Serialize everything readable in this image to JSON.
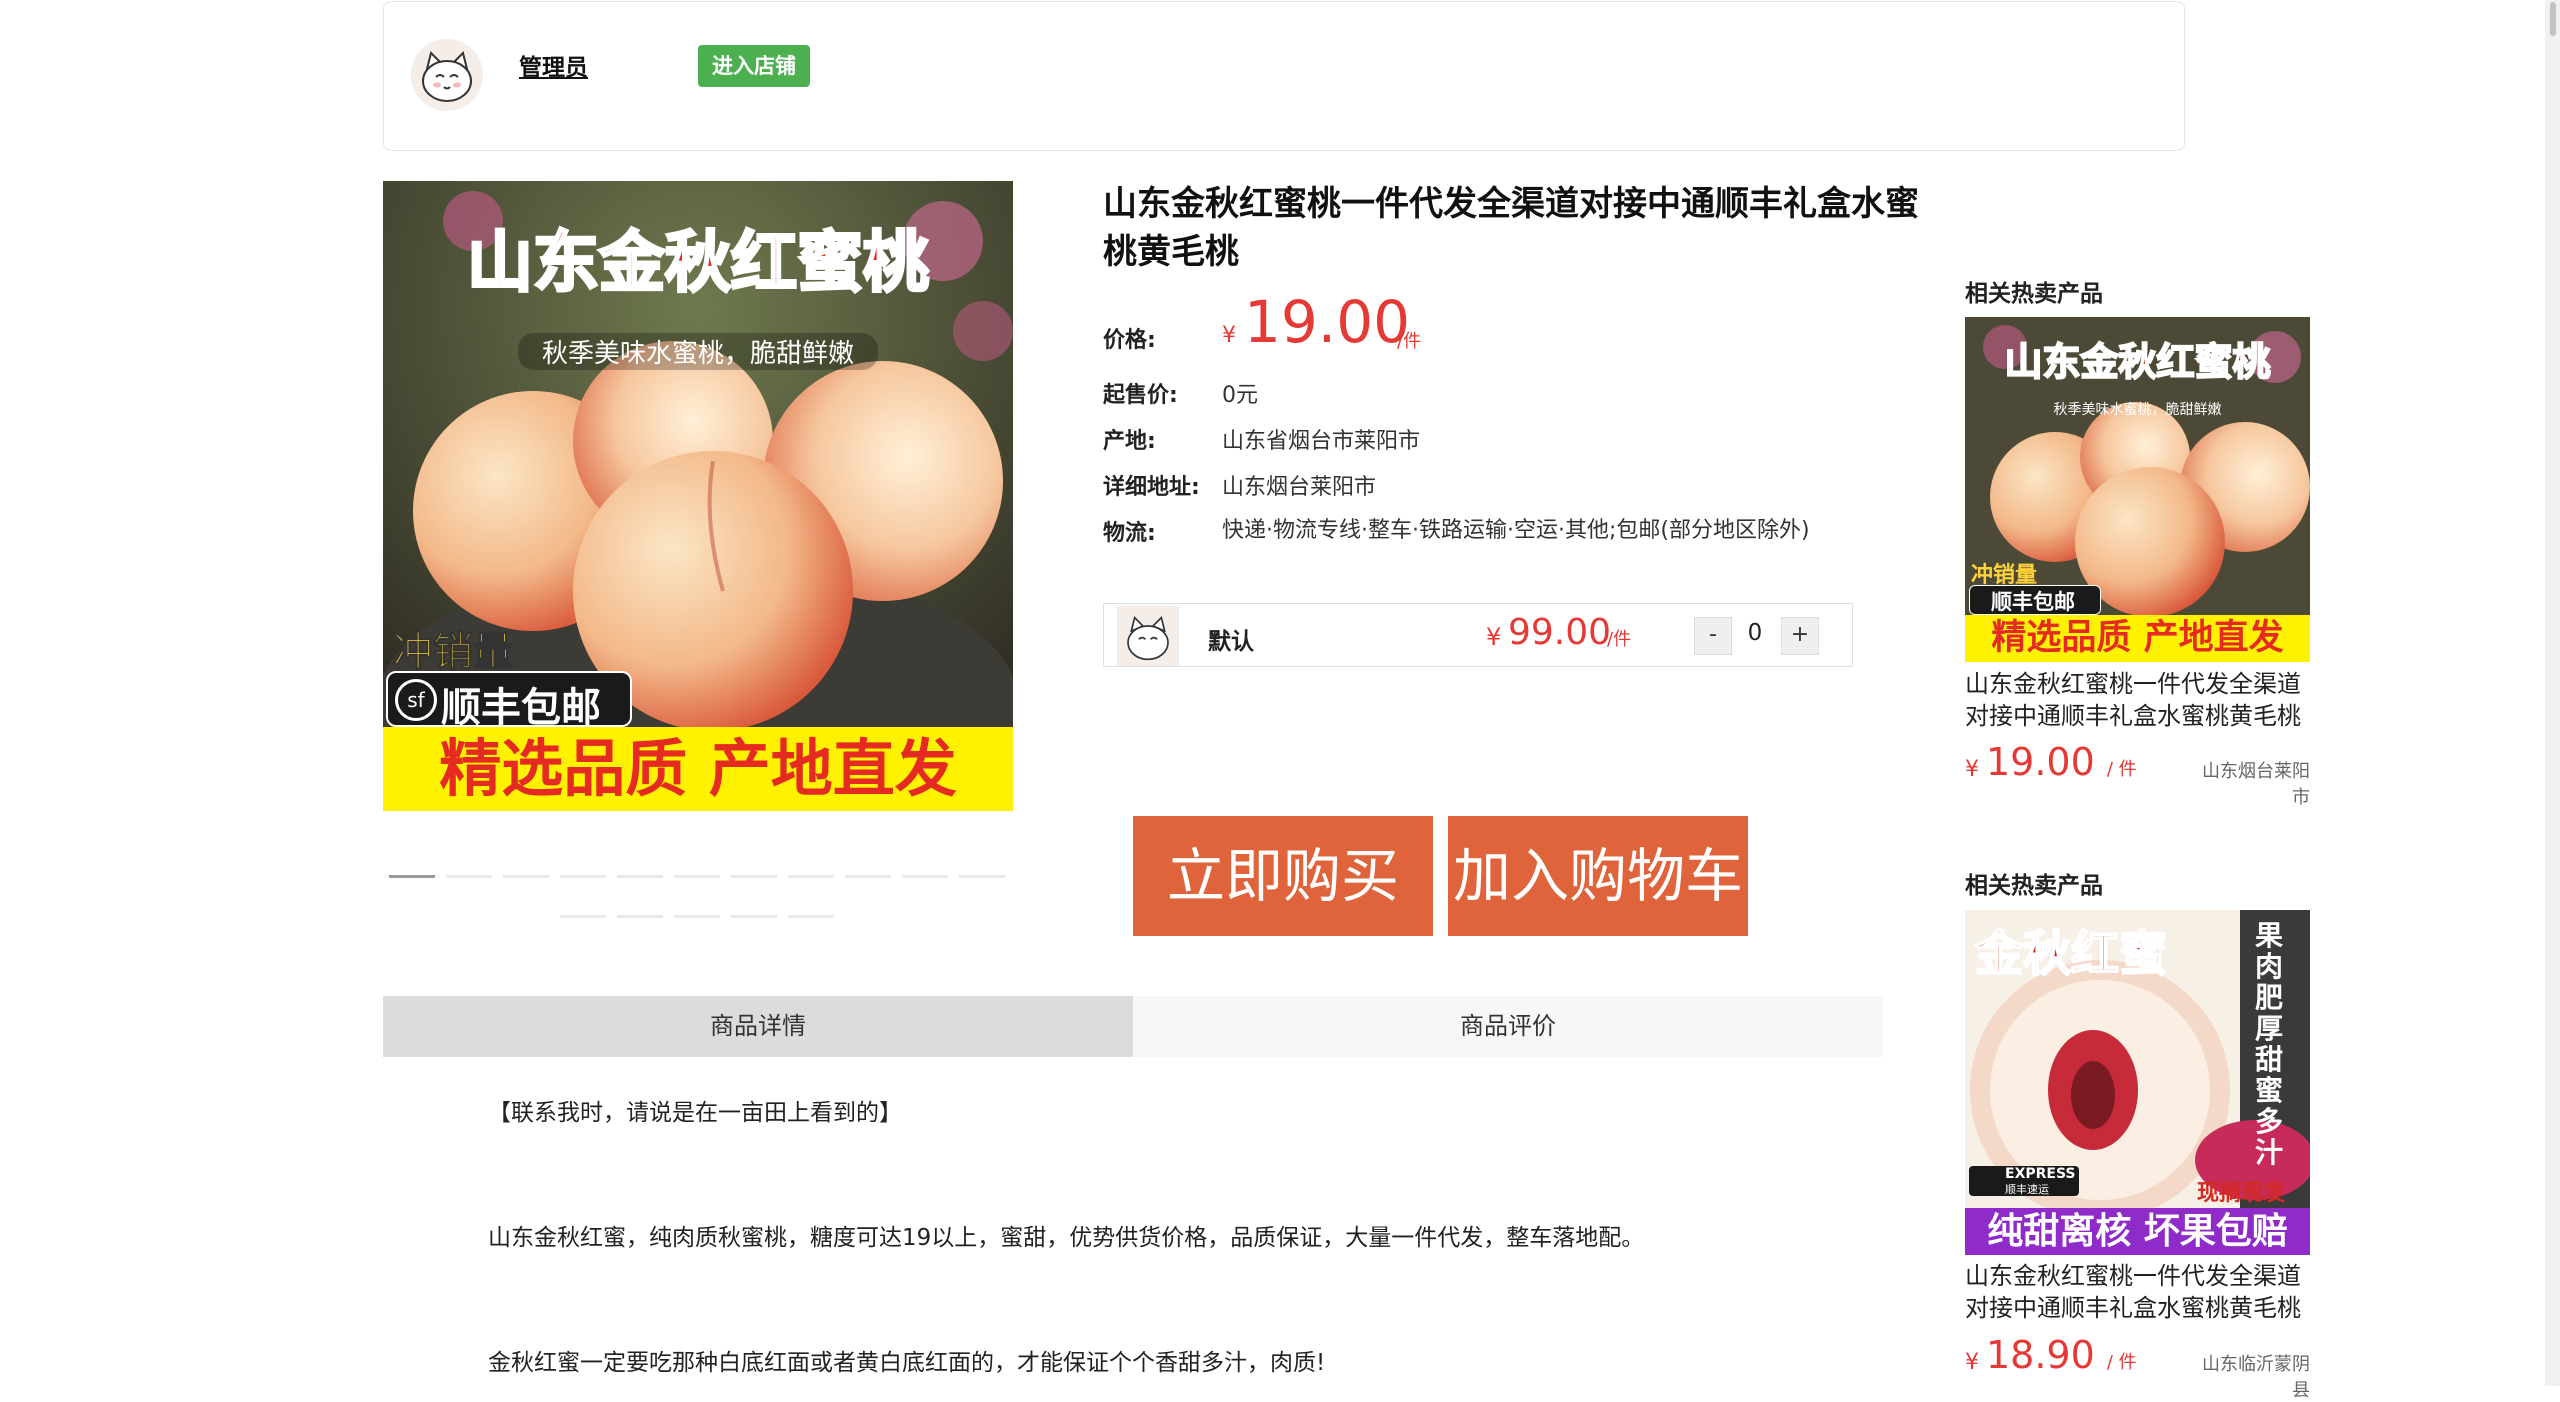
{
  "shop": {
    "name": "管理员",
    "enter_button": "进入店铺"
  },
  "main_image": {
    "headline": "山东金秋红蜜桃",
    "subline": "秋季美味水蜜桃，脆甜鲜嫩",
    "sticker_top": "冲销量",
    "sticker_sf": "顺丰包邮",
    "banner": "精选品质 产地直发",
    "sf_logo": "sf"
  },
  "product": {
    "title": "山东金秋红蜜桃一件代发全渠道对接中通顺丰礼盒水蜜桃黄毛桃",
    "price_label": "价格:",
    "currency": "¥",
    "price": "19.00",
    "price_unit": "/件",
    "min_label": "起售价:",
    "min_value": "0元",
    "origin_label": "产地:",
    "origin_value": "山东省烟台市莱阳市",
    "address_label": "详细地址:",
    "address_value": "山东烟台莱阳市",
    "logistics_label": "物流:",
    "logistics_value": "快递·物流专线·整车·铁路运输·空运·其他;包邮(部分地区除外)"
  },
  "sku": {
    "name": "默认",
    "currency": "¥",
    "price": "99.00",
    "unit": "/件",
    "minus": "-",
    "qty": "0",
    "plus": "+"
  },
  "actions": {
    "buy_now": "立即购买",
    "add_cart": "加入购物车"
  },
  "tabs": {
    "details": "商品详情",
    "reviews": "商品评价"
  },
  "detail_paragraphs": [
    "【联系我时，请说是在一亩田上看到的】",
    "山东金秋红蜜，纯肉质秋蜜桃，糖度可达19以上，蜜甜，优势供货价格，品质保证，大量一件代发，整车落地配。",
    "金秋红蜜一定要吃那种白底红面或者黄白底红面的，才能保证个个香甜多汁，肉质!"
  ],
  "sidebar": [
    {
      "heading": "相关热卖产品",
      "img_headline": "山东金秋红蜜桃",
      "img_sub": "秋季美味水蜜桃，脆甜鲜嫩",
      "img_sticker_top": "冲销量",
      "img_sticker_sf": "顺丰包邮",
      "img_banner": "精选品质 产地直发",
      "name": "山东金秋红蜜桃一件代发全渠道对接中通顺丰礼盒水蜜桃黄毛桃",
      "currency": "¥",
      "price": "19.00",
      "unit": "/ 件",
      "location": "山东烟台莱阳市"
    },
    {
      "heading": "相关热卖产品",
      "img_headline": "金秋红蜜",
      "img_side": "果肉肥厚甜蜜多汁",
      "img_express": "EXPRESS",
      "img_express_cn": "顺丰速运",
      "img_tag": "现摘现发",
      "img_banner": "纯甜离核 坏果包赔",
      "name": "山东金秋红蜜桃一件代发全渠道对接中通顺丰礼盒水蜜桃黄毛桃",
      "currency": "¥",
      "price": "18.90",
      "unit": "/ 件",
      "location": "山东临沂蒙阴县"
    }
  ],
  "colors": {
    "accent_red": "#e53935",
    "button_orange": "#e0643b",
    "shop_green": "#4caf50"
  }
}
